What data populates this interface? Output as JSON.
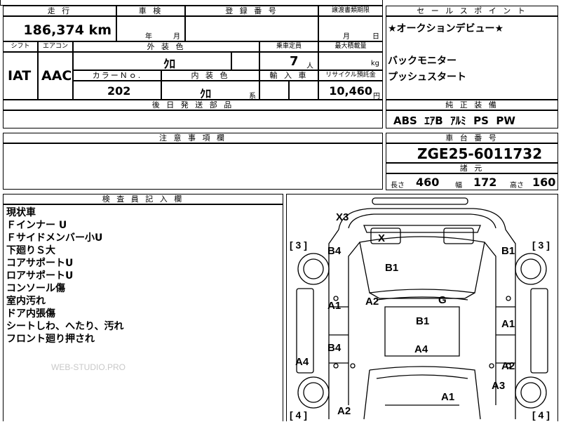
{
  "sheet": {
    "top_left_fragment": "",
    "mileage": {
      "label": "走 行",
      "value": "186,374 km"
    },
    "inspection": {
      "label": "車 検",
      "year": "年",
      "month": "月"
    },
    "registration": {
      "label": "登 録 番 号",
      "value": ""
    },
    "transfer": {
      "label": "譲渡書類期限",
      "month": "月",
      "day": "日"
    },
    "shift": {
      "label": "シフト",
      "value": "IAT"
    },
    "aircon": {
      "label": "エアコン",
      "value": "AAC"
    },
    "exterior": {
      "label": "外 装 色",
      "value": "ｸﾛ"
    },
    "capacity": {
      "label": "乗車定員",
      "value": "7",
      "unit": "人"
    },
    "max_load": {
      "label": "最大積載量",
      "unit": "kg"
    },
    "color_no": {
      "label": "カラーＮｏ.",
      "value": "202"
    },
    "interior": {
      "label": "内 装 色",
      "value": "ｸﾛ",
      "suffix": "系"
    },
    "import": {
      "label": "輸 入 車"
    },
    "recycle": {
      "label": "リサイクル預託金",
      "value": "10,460",
      "unit": "円"
    },
    "later_parts": {
      "label": "後 日 発 送 部 品"
    },
    "caution": {
      "label": "注 意 事 項 欄"
    },
    "sales_point": {
      "label": "セ ー ル ス ポ イ ン ト",
      "lines": [
        "★オークションデビュー★",
        "",
        "バックモニター",
        "プッシュスタート"
      ]
    },
    "equipment": {
      "label": "純 正 装 備",
      "value": "ABS  ｴｱB  ｱﾙﾐ  PS  PW"
    },
    "chassis": {
      "label": "車 台 番 号",
      "value": "ZGE25-6011732"
    },
    "specs": {
      "label": "諸 元",
      "length_label": "長さ",
      "length": "460",
      "width_label": "幅",
      "width": "172",
      "height_label": "高さ",
      "height": "160"
    },
    "inspector": {
      "label": "検 査 員 記 入 欄",
      "lines": [
        "現状車",
        "Ｆインナー U",
        "Ｆサイドメンバー小U",
        "下廻りＳ大",
        "コアサポートU",
        "ロアサポートU",
        "コンソール傷",
        "室内汚れ",
        "ドア内張傷",
        "シートしわ、へたり、汚れ",
        "フロント廻り押され"
      ],
      "watermark": "WEB-STUDIO.PRO"
    },
    "diagram": {
      "marks": [
        "X3",
        "X",
        "B4",
        "B1",
        "B1",
        "A1",
        "A2",
        "G",
        "B1",
        "A1",
        "B4",
        "A4",
        "A4",
        "A2",
        "A3",
        "A1",
        "A2"
      ],
      "tire_left_top": "[ 3 ]",
      "tire_right_top": "[ 3 ]",
      "tire_left_bottom": "[ 4 ]",
      "tire_right_bottom": "[ 4 ]"
    }
  }
}
